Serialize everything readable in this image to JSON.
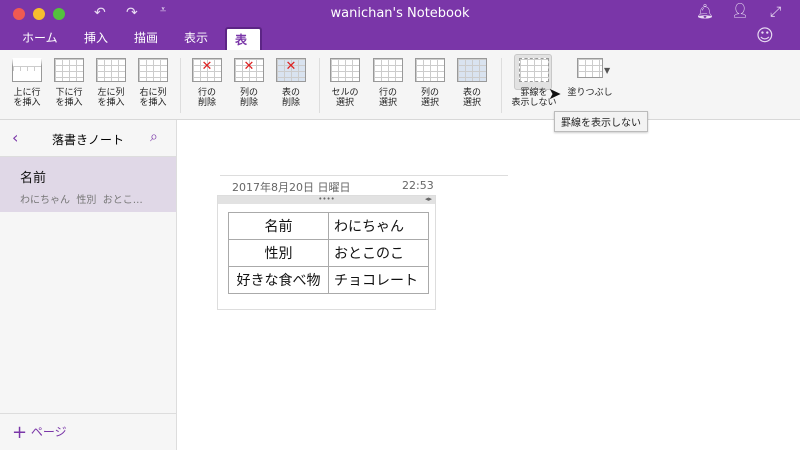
{
  "window": {
    "title": "wanichan's Notebook"
  },
  "quick_access": [
    "undo-icon",
    "redo-icon",
    "customize-icon"
  ],
  "tabs": [
    {
      "label": "ホーム"
    },
    {
      "label": "挿入"
    },
    {
      "label": "描画"
    },
    {
      "label": "表示"
    },
    {
      "label": "表",
      "active": true
    }
  ],
  "ribbon": {
    "insert_above": "上に行\nを挿入",
    "insert_below": "下に行\nを挿入",
    "insert_left": "左に列\nを挿入",
    "insert_right": "右に列\nを挿入",
    "delete_row": "行の\n削除",
    "delete_col": "列の\n削除",
    "delete_table": "表の\n削除",
    "select_cell": "セルの\n選択",
    "select_row": "行の\n選択",
    "select_col": "列の\n選択",
    "select_table": "表の\n選択",
    "hide_borders": "罫線を\n表示しない",
    "shading": "塗りつぶし"
  },
  "tooltip": "罫線を表示しない",
  "sidebar": {
    "section": "落書きノート",
    "pages": [
      {
        "title": "名前",
        "preview": "わにちゃん  性別  おとこ…",
        "selected": true
      }
    ],
    "add_page": "ページ"
  },
  "note": {
    "date": "2017年8月20日 日曜日",
    "time": "22:53",
    "table": [
      [
        "名前",
        "わにちゃん"
      ],
      [
        "性別",
        "おとこのこ"
      ],
      [
        "好きな食べ物",
        "チョコレート"
      ]
    ]
  },
  "colors": {
    "accent": "#7a36a8",
    "selected": "#e0d8e7"
  }
}
